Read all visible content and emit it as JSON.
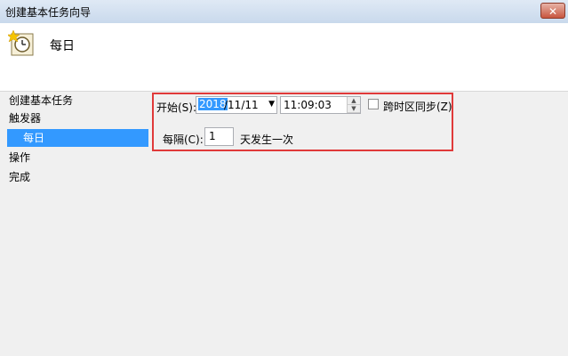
{
  "window": {
    "title": "创建基本任务向导",
    "close_glyph": "✕"
  },
  "header": {
    "title": "每日",
    "icon": "clock-icon"
  },
  "sidebar": {
    "items": [
      {
        "label": "创建基本任务"
      },
      {
        "label": "触发器"
      },
      {
        "label": "每日"
      },
      {
        "label": "操作"
      },
      {
        "label": "完成"
      }
    ]
  },
  "schedule": {
    "start_label": "开始(S):",
    "date_year": "2018",
    "date_rest": "/11/11",
    "dropdown_glyph": "▼",
    "time_value": "11:09:03",
    "sync_timezones_label": "跨时区同步(Z)",
    "recur_every_label": "每隔(C):",
    "recur_value": "1",
    "recur_suffix": "天发生一次"
  },
  "colors": {
    "selection": "#3399ff",
    "highlight_border": "#e03a3a"
  }
}
